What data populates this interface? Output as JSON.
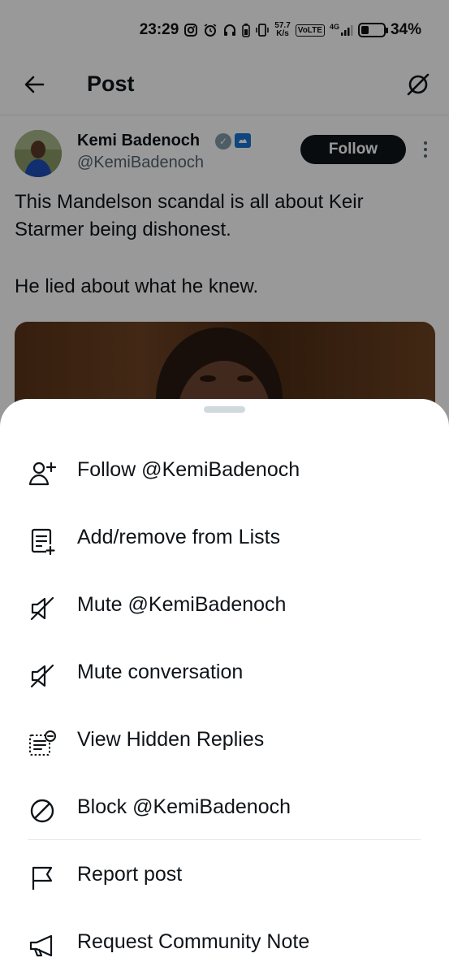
{
  "status_bar": {
    "time": "23:29",
    "speed_value": "57.7",
    "speed_unit": "K/s",
    "volte": "VoLTE",
    "network": "4G",
    "battery_percent": "34%",
    "battery_level": 0.34
  },
  "header": {
    "title": "Post"
  },
  "post": {
    "author_name": "Kemi Badenoch",
    "author_handle": "@KemiBadenoch",
    "follow_label": "Follow",
    "text_line_1": "This Mandelson scandal is all about Keir Starmer being dishonest.",
    "text_line_2": "He lied about what he knew."
  },
  "menu": {
    "items": [
      {
        "label": "Follow @KemiBadenoch",
        "icon": "follow-user-icon"
      },
      {
        "label": "Add/remove from Lists",
        "icon": "lists-icon"
      },
      {
        "label": "Mute @KemiBadenoch",
        "icon": "mute-icon"
      },
      {
        "label": "Mute conversation",
        "icon": "mute-icon"
      },
      {
        "label": "View Hidden Replies",
        "icon": "hidden-replies-icon"
      },
      {
        "label": "Block @KemiBadenoch",
        "icon": "block-icon"
      },
      {
        "label": "Report post",
        "icon": "flag-icon"
      },
      {
        "label": "Request Community Note",
        "icon": "megaphone-icon"
      }
    ]
  },
  "colors": {
    "text": "#0f1419",
    "secondary_text": "#536471",
    "follow_button": "#0f1419",
    "scrim": "rgba(0,0,0,0.40)"
  }
}
